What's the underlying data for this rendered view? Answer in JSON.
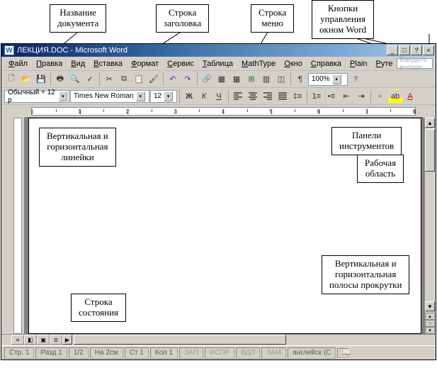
{
  "callouts": {
    "doc_name": "Название\nдокумента",
    "titlebar_row": "Строка\nзаголовка",
    "menu_row": "Строка\nменю",
    "win_ctrl": "Кнопки\nуправления\nокном Word",
    "rulers": "Вертикальная и\nгоризонтальная\nлинейки",
    "toolbars": "Панели\nинструментов",
    "workarea": "Рабочая\nобласть",
    "scrollbars": "Вертикальная и\nгоризонтальная\nполосы прокрутки",
    "statusbar": "Строка\nсостояния"
  },
  "window": {
    "title": "ЛЕКЦИЯ.DOC - Microsoft Word",
    "icon_letter": "W",
    "buttons": {
      "min": "_",
      "max": "□",
      "help": "?",
      "close": "×"
    }
  },
  "menu": {
    "items": [
      "Файл",
      "Правка",
      "Вид",
      "Вставка",
      "Формат",
      "Сервис",
      "Таблица",
      "MathType",
      "Окно",
      "Справка",
      "Plain",
      "Руте"
    ],
    "ask": "Введите вопрос"
  },
  "toolbar2": {
    "style": "Обычный + 12 p",
    "font": "Times New Roman",
    "size": "12"
  },
  "status": {
    "page": "Стр. 1",
    "sec": "Разд 1",
    "pages": "1/2",
    "at": "На 2см",
    "ln": "Ст 1",
    "col": "Кол 1",
    "rec": "ЗАП",
    "trk": "ИСПР",
    "ext": "ВДЛ",
    "ovr": "ЗАМ",
    "lang": "английск (С"
  },
  "icons": {
    "new": "N",
    "open": "O",
    "save": "S",
    "print": "P",
    "preview": "V",
    "spell": "✓",
    "cut": "✂",
    "copy": "C",
    "paste": "P",
    "undo": "↶",
    "redo": "↷",
    "table": "T",
    "zoom": "100%",
    "bold": "Ж",
    "italic": "К",
    "underline": "Ч",
    "align_l": "≡",
    "align_c": "≡",
    "align_r": "≡",
    "align_j": "≡",
    "linesp": "‡",
    "numlist": "1",
    "bullist": "•",
    "outdent": "←",
    "indent": "→",
    "border": "□",
    "highlight": "ab",
    "fontcolor": "A"
  }
}
